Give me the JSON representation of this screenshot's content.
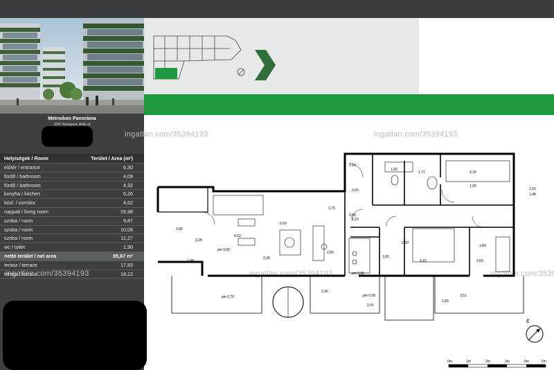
{
  "project": {
    "name": "Metrodom Panoráma",
    "address": "1047 Budapest, Attila út"
  },
  "watermark": "ingatlan.com/35394193",
  "areas": {
    "header_room": "Helyiségek / Room",
    "header_area": "Terület / Area (m²)",
    "rows": [
      {
        "room": "előtér / entrance",
        "area": "6,30"
      },
      {
        "room": "fürdő / bathroom",
        "area": "4,09"
      },
      {
        "room": "fürdő / bathroom",
        "area": "4,32"
      },
      {
        "room": "konyha / kitchen",
        "area": "6,26"
      },
      {
        "room": "közl. / corridor",
        "area": "4,62"
      },
      {
        "room": "nappali / living room",
        "area": "26,98"
      },
      {
        "room": "szoba / room",
        "area": "9,87"
      },
      {
        "room": "szoba / room",
        "area": "10,06"
      },
      {
        "room": "szoba / room",
        "area": "11,27"
      },
      {
        "room": "wc / toilet",
        "area": "1,90"
      }
    ],
    "total_label": "nettó terület / net area",
    "total_value": "85,67 m²",
    "terraces": [
      {
        "room": "terasz / terrace",
        "area": "17,83"
      },
      {
        "room": "terasz / terrace",
        "area": "18,12"
      }
    ]
  },
  "plan_labels": {
    "dims": [
      "6,60",
      "4,15",
      "4,18",
      "2,20",
      "1,71",
      "1,88",
      "2,60",
      "2,40",
      "2,41",
      "1,89",
      "3,28",
      "2,89",
      "1,50",
      "1,48",
      "3,51",
      "1,80",
      "2,65",
      "2,00",
      "2,10",
      "1,83",
      "1,20",
      "1,00",
      "4,52",
      "3,65",
      "1,75",
      "2,12",
      "0,60"
    ],
    "pm": [
      "pm 0,60",
      "pm 0,85",
      "pm 0,00",
      "pm 0,70"
    ],
    "compass": "É"
  },
  "scale": {
    "labels": [
      "0m",
      "1m",
      "2m",
      "3m",
      "4m",
      "5m"
    ]
  },
  "colors": {
    "green": "#1e9a3c",
    "dark": "#3d3f40",
    "arrow": "#2f6f3a"
  }
}
